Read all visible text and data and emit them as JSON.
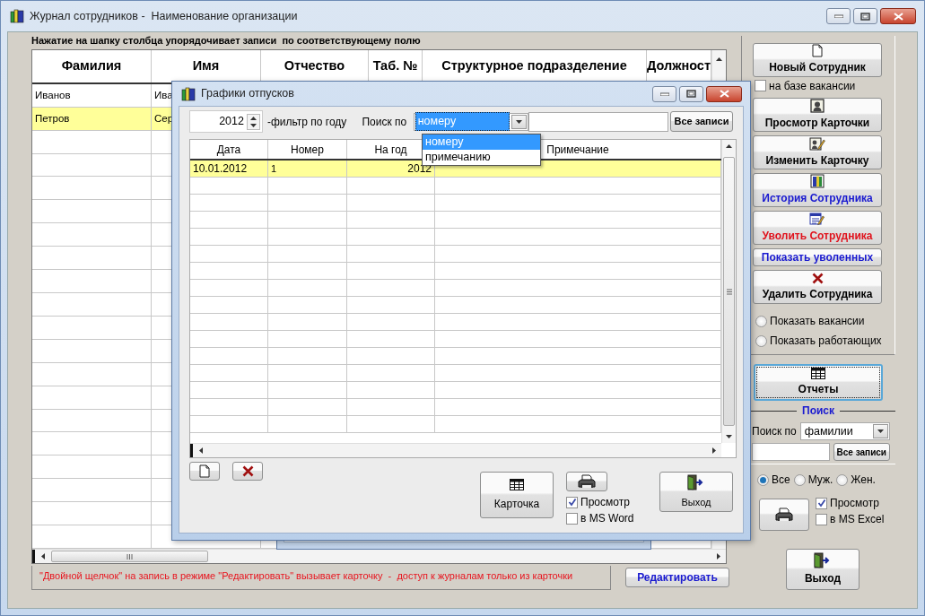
{
  "window": {
    "title": "Журнал сотрудников -  Наименование организации"
  },
  "hint": "Нажатие на шапку столбца упорядочивает записи  по соответствующему полю",
  "employees_table": {
    "columns": [
      "Фамилия",
      "Имя",
      "Отчество",
      "Таб. №",
      "Структурное подразделение",
      "Должност"
    ],
    "rows": [
      {
        "cells": [
          "Иванов",
          "Ива"
        ],
        "selected": false
      },
      {
        "cells": [
          "Петров",
          "Сер"
        ],
        "selected": true
      }
    ]
  },
  "footer_note": "\"Двойной щелчок\" на запись в режиме \"Редактировать\" вызывает карточку  -  доступ к журналам только из карточки",
  "edit_button": "Редактировать",
  "actions": [
    {
      "kind": "icon_button",
      "label": "Новый Сотрудник",
      "color": "#000000"
    },
    {
      "kind": "checkbox",
      "label": "на базе вакансии",
      "checked": false
    },
    {
      "kind": "icon_button",
      "label": "Просмотр Карточки",
      "color": "#000000"
    },
    {
      "kind": "icon_button",
      "label": "Изменить Карточку",
      "color": "#000000"
    },
    {
      "kind": "icon_button",
      "label": "История Сотрудника",
      "color": "#1a1ad0"
    },
    {
      "kind": "icon_button",
      "label": "Уволить Сотрудника",
      "color": "#e0121c"
    },
    {
      "kind": "text_button",
      "label": "Показать уволенных",
      "color": "#1a1ad0"
    },
    {
      "kind": "icon_button",
      "label": "Удалить Сотрудника",
      "color": "#000000"
    },
    {
      "kind": "radio",
      "label": "Показать вакансии",
      "selected": false
    },
    {
      "kind": "radio",
      "label": "Показать работающих",
      "selected": false
    }
  ],
  "reports_button": {
    "label": "Отчеты",
    "focused": true
  },
  "search": {
    "legend": "Поиск",
    "label": "Поиск по",
    "field": "фамилии",
    "button": "Все записи",
    "gender": [
      {
        "label": "Все",
        "selected": true
      },
      {
        "label": "Муж.",
        "selected": false
      },
      {
        "label": "Жен.",
        "selected": false
      }
    ]
  },
  "print_options": [
    {
      "label": "Просмотр",
      "checked": true
    },
    {
      "label": "в MS Excel",
      "checked": false
    }
  ],
  "exit_button": "Выход",
  "dialog": {
    "title": "Графики отпусков",
    "year": "2012",
    "year_label": "-фильтр по году",
    "search_label": "Поиск по",
    "search_field": "номеру",
    "dropdown": [
      {
        "label": "номеру",
        "selected": true
      },
      {
        "label": "примечанию",
        "selected": false
      }
    ],
    "all_button": "Все записи",
    "table": {
      "columns": [
        "Дата",
        "Номер",
        "На год",
        "Примечание"
      ],
      "rows": [
        {
          "cells": [
            "10.01.2012",
            "1",
            "2012"
          ],
          "selected": true
        }
      ]
    },
    "card_button": "Карточка",
    "print_options": [
      {
        "label": "Просмотр",
        "checked": true
      },
      {
        "label": "в MS Word",
        "checked": false
      }
    ],
    "exit_button": "Выход"
  }
}
